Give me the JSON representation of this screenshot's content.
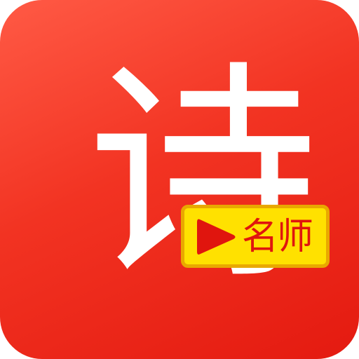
{
  "app_icon": {
    "main_character": "诗",
    "badge_text": "名师",
    "play_icon": "play-icon",
    "colors": {
      "background_top": "#ff5a45",
      "background_bottom": "#e41a10",
      "character": "#ffffff",
      "badge_fill": "#ffe100",
      "badge_border": "#e9a800",
      "badge_text": "#e0150e",
      "play_fill": "#e0150e"
    }
  }
}
